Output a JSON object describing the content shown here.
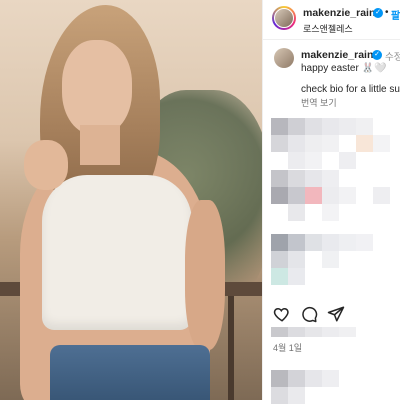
{
  "post": {
    "image_alt": "Young woman with long blonde hair wearing a white crop top and jeans, posing by a railing outdoors"
  },
  "header": {
    "username": "makenzie_raine",
    "separator": "•",
    "follow_label": "팔로",
    "location": "로스앤젤레스"
  },
  "caption": {
    "username": "makenzie_raine",
    "edited_label": "수정함",
    "line1": "happy easter 🐰🤍",
    "line2": "check bio for a little surp",
    "translate_label": "번역 보기"
  },
  "meta": {
    "date": "4월 1일"
  },
  "icons": {
    "like": "heart-icon",
    "comment": "comment-icon",
    "share": "send-icon",
    "verified": "verified-badge-icon"
  },
  "colors": {
    "accent": "#0095f6",
    "text": "#262626",
    "muted": "#737373"
  }
}
